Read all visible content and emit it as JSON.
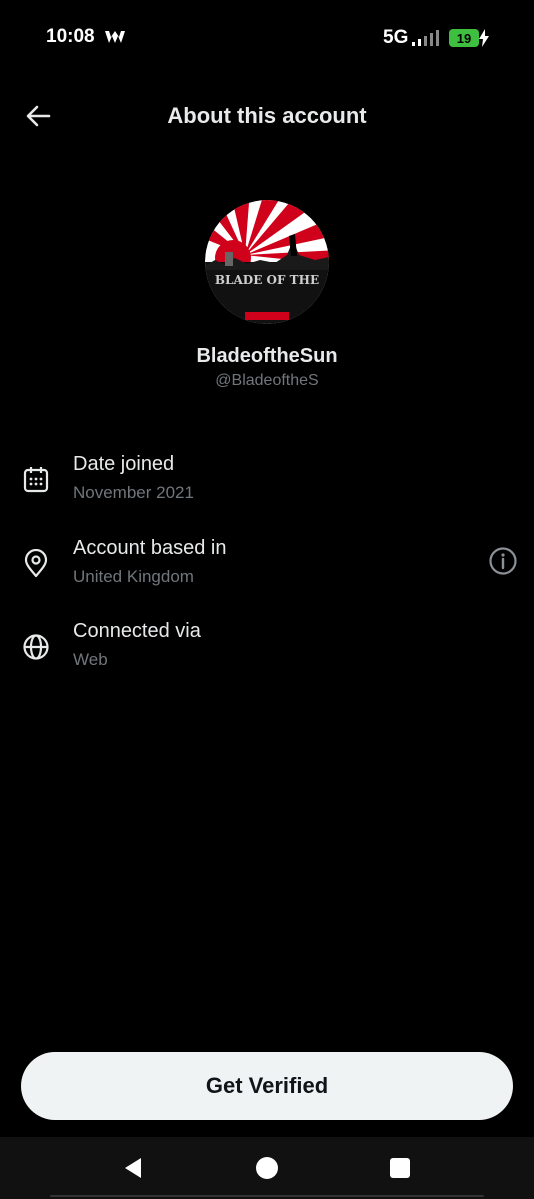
{
  "status_bar": {
    "time": "10:08",
    "network": "5G",
    "battery": "19",
    "battery_color": "#3fbf3f"
  },
  "header": {
    "title": "About this account",
    "back_icon": "arrow-left-icon"
  },
  "profile": {
    "display_name": "BladeoftheSun",
    "handle": "@BladeoftheS",
    "avatar_text": "BLADE OF THE"
  },
  "info": [
    {
      "icon": "calendar-icon",
      "label": "Date joined",
      "value": "November 2021"
    },
    {
      "icon": "location-pin-icon",
      "label": "Account based in",
      "value": "United Kingdom",
      "action_icon": "info-icon"
    },
    {
      "icon": "globe-icon",
      "label": "Connected via",
      "value": "Web"
    }
  ],
  "cta": {
    "label": "Get Verified"
  },
  "colors": {
    "background": "#000000",
    "primary_text": "#e7e9ea",
    "secondary_text": "#71767b",
    "button_bg": "#eff3f4",
    "button_text": "#0f1419"
  }
}
